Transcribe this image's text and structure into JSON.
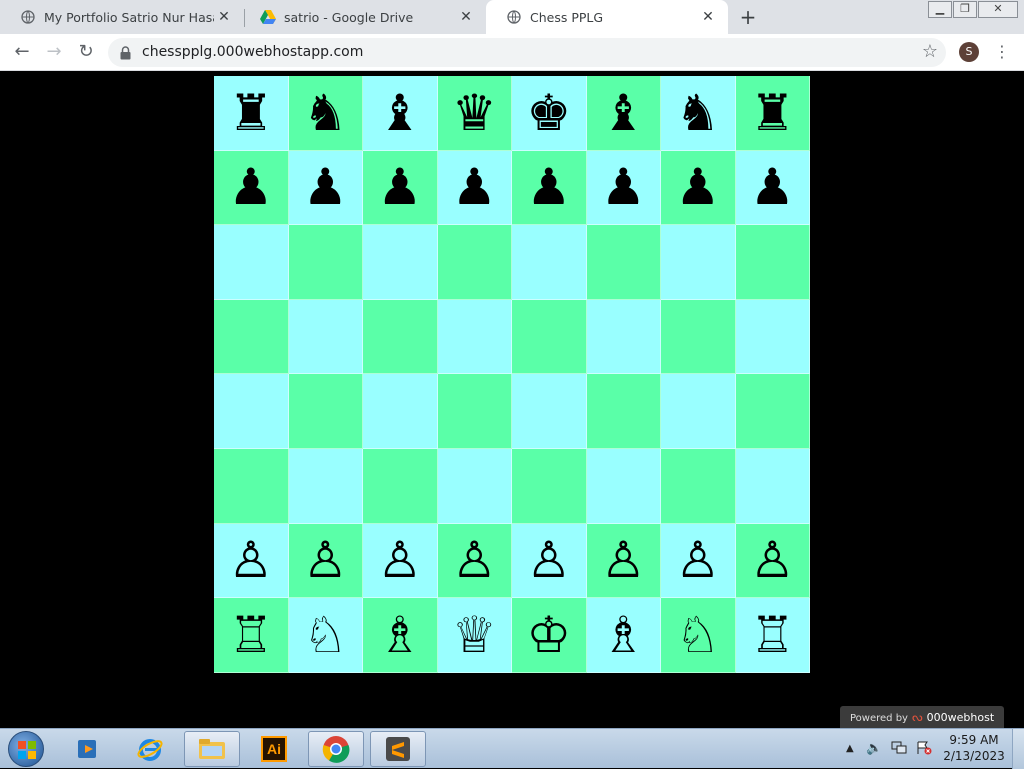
{
  "browser": {
    "tabs": [
      {
        "title": "My Portfolio Satrio Nur Hasan",
        "icon": "globe-icon",
        "active": false
      },
      {
        "title": "satrio - Google Drive",
        "icon": "google-drive-icon",
        "active": false
      },
      {
        "title": "Chess PPLG",
        "icon": "globe-icon",
        "active": true
      }
    ],
    "new_tab_label": "+",
    "address": "chesspplg.000webhostapp.com",
    "profile_initial": "S"
  },
  "board": {
    "light_color": "#99ffff",
    "dark_color": "#5affa8",
    "ranks": [
      [
        "♜",
        "♞",
        "♝",
        "♛",
        "♚",
        "♝",
        "♞",
        "♜"
      ],
      [
        "♟",
        "♟",
        "♟",
        "♟",
        "♟",
        "♟",
        "♟",
        "♟"
      ],
      [
        "",
        "",
        "",
        "",
        "",
        "",
        "",
        ""
      ],
      [
        "",
        "",
        "",
        "",
        "",
        "",
        "",
        ""
      ],
      [
        "",
        "",
        "",
        "",
        "",
        "",
        "",
        ""
      ],
      [
        "",
        "",
        "",
        "",
        "",
        "",
        "",
        ""
      ],
      [
        "♙",
        "♙",
        "♙",
        "♙",
        "♙",
        "♙",
        "♙",
        "♙"
      ],
      [
        "♖",
        "♘",
        "♗",
        "♕",
        "♔",
        "♗",
        "♘",
        "♖"
      ]
    ]
  },
  "powered": {
    "prefix": "Powered by",
    "brand": "000webhost"
  },
  "taskbar": {
    "apps": [
      "media-player-icon",
      "internet-explorer-icon",
      "file-explorer-icon",
      "illustrator-icon",
      "chrome-icon",
      "sublime-text-icon"
    ],
    "illustrator_label": "Ai",
    "time": "9:59 AM",
    "date": "2/13/2023"
  }
}
